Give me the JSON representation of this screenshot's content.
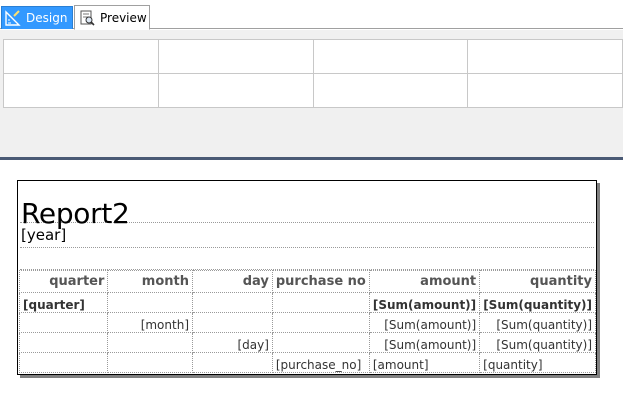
{
  "tabs": [
    {
      "label": "Design",
      "icon": "design-ruler-icon",
      "active": true
    },
    {
      "label": "Preview",
      "icon": "preview-page-icon",
      "active": false
    }
  ],
  "report": {
    "title": "Report2",
    "year_field": "[year]",
    "headers": [
      "quarter",
      "month",
      "day",
      "purchase no",
      "amount",
      "quantity"
    ],
    "rows": [
      [
        "[quarter]",
        "",
        "",
        "",
        "[Sum(amount)]",
        "[Sum(quantity)]"
      ],
      [
        "",
        "[month]",
        "",
        "",
        "[Sum(amount)]",
        "[Sum(quantity)]"
      ],
      [
        "",
        "",
        "[day]",
        "",
        "[Sum(amount)]",
        "[Sum(quantity)]"
      ],
      [
        "",
        "",
        "",
        "[purchase_no]",
        "[amount]",
        "[quantity]"
      ]
    ]
  },
  "colors": {
    "active_tab": "#3399ff",
    "divider": "#4a5a75"
  }
}
